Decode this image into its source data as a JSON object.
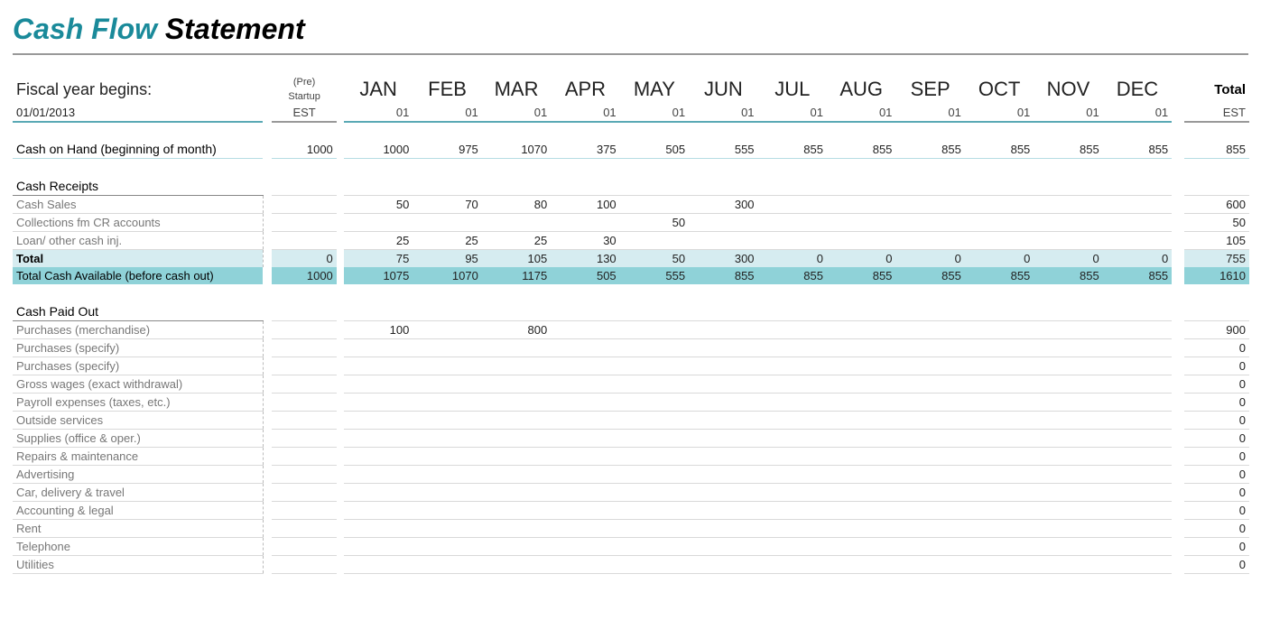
{
  "title": {
    "part1": "Cash Flow",
    "part2": "Statement"
  },
  "fiscal": {
    "label": "Fiscal year begins:",
    "date": "01/01/2013"
  },
  "header": {
    "preTop": "(Pre)",
    "preMid": "Startup",
    "preBot": "EST",
    "months": [
      "JAN",
      "FEB",
      "MAR",
      "APR",
      "MAY",
      "JUN",
      "JUL",
      "AUG",
      "SEP",
      "OCT",
      "NOV",
      "DEC"
    ],
    "monthSub": "01",
    "totalTop": "Total",
    "totalBot": "EST"
  },
  "cashOnHand": {
    "label": "Cash on Hand (beginning of month)",
    "pre": "1000",
    "m": [
      "1000",
      "975",
      "1070",
      "375",
      "505",
      "555",
      "855",
      "855",
      "855",
      "855",
      "855",
      "855"
    ],
    "total": "855"
  },
  "receipts": {
    "heading": "Cash Receipts",
    "rows": [
      {
        "label": "Cash Sales",
        "pre": "",
        "m": [
          "50",
          "70",
          "80",
          "100",
          "",
          "300",
          "",
          "",
          "",
          "",
          "",
          ""
        ],
        "total": "600"
      },
      {
        "label": "Collections fm CR accounts",
        "pre": "",
        "m": [
          "",
          "",
          "",
          "",
          "50",
          "",
          "",
          "",
          "",
          "",
          "",
          ""
        ],
        "total": "50"
      },
      {
        "label": "Loan/ other cash inj.",
        "pre": "",
        "m": [
          "25",
          "25",
          "25",
          "30",
          "",
          "",
          "",
          "",
          "",
          "",
          "",
          ""
        ],
        "total": "105"
      }
    ],
    "subtotal": {
      "label": "Total",
      "pre": "0",
      "m": [
        "75",
        "95",
        "105",
        "130",
        "50",
        "300",
        "0",
        "0",
        "0",
        "0",
        "0",
        "0"
      ],
      "total": "755"
    },
    "available": {
      "label": "Total Cash Available (before cash out)",
      "pre": "1000",
      "m": [
        "1075",
        "1070",
        "1175",
        "505",
        "555",
        "855",
        "855",
        "855",
        "855",
        "855",
        "855",
        "855"
      ],
      "total": "1610"
    }
  },
  "paidOut": {
    "heading": "Cash Paid Out",
    "rows": [
      {
        "label": "Purchases (merchandise)",
        "pre": "",
        "m": [
          "100",
          "",
          "800",
          "",
          "",
          "",
          "",
          "",
          "",
          "",
          "",
          ""
        ],
        "total": "900"
      },
      {
        "label": "Purchases (specify)",
        "pre": "",
        "m": [
          "",
          "",
          "",
          "",
          "",
          "",
          "",
          "",
          "",
          "",
          "",
          ""
        ],
        "total": "0"
      },
      {
        "label": "Purchases (specify)",
        "pre": "",
        "m": [
          "",
          "",
          "",
          "",
          "",
          "",
          "",
          "",
          "",
          "",
          "",
          ""
        ],
        "total": "0"
      },
      {
        "label": "Gross wages (exact withdrawal)",
        "pre": "",
        "m": [
          "",
          "",
          "",
          "",
          "",
          "",
          "",
          "",
          "",
          "",
          "",
          ""
        ],
        "total": "0"
      },
      {
        "label": "Payroll expenses (taxes, etc.)",
        "pre": "",
        "m": [
          "",
          "",
          "",
          "",
          "",
          "",
          "",
          "",
          "",
          "",
          "",
          ""
        ],
        "total": "0"
      },
      {
        "label": "Outside services",
        "pre": "",
        "m": [
          "",
          "",
          "",
          "",
          "",
          "",
          "",
          "",
          "",
          "",
          "",
          ""
        ],
        "total": "0"
      },
      {
        "label": "Supplies (office & oper.)",
        "pre": "",
        "m": [
          "",
          "",
          "",
          "",
          "",
          "",
          "",
          "",
          "",
          "",
          "",
          ""
        ],
        "total": "0"
      },
      {
        "label": "Repairs & maintenance",
        "pre": "",
        "m": [
          "",
          "",
          "",
          "",
          "",
          "",
          "",
          "",
          "",
          "",
          "",
          ""
        ],
        "total": "0"
      },
      {
        "label": "Advertising",
        "pre": "",
        "m": [
          "",
          "",
          "",
          "",
          "",
          "",
          "",
          "",
          "",
          "",
          "",
          ""
        ],
        "total": "0"
      },
      {
        "label": "Car, delivery & travel",
        "pre": "",
        "m": [
          "",
          "",
          "",
          "",
          "",
          "",
          "",
          "",
          "",
          "",
          "",
          ""
        ],
        "total": "0"
      },
      {
        "label": "Accounting & legal",
        "pre": "",
        "m": [
          "",
          "",
          "",
          "",
          "",
          "",
          "",
          "",
          "",
          "",
          "",
          ""
        ],
        "total": "0"
      },
      {
        "label": "Rent",
        "pre": "",
        "m": [
          "",
          "",
          "",
          "",
          "",
          "",
          "",
          "",
          "",
          "",
          "",
          ""
        ],
        "total": "0"
      },
      {
        "label": "Telephone",
        "pre": "",
        "m": [
          "",
          "",
          "",
          "",
          "",
          "",
          "",
          "",
          "",
          "",
          "",
          ""
        ],
        "total": "0"
      },
      {
        "label": "Utilities",
        "pre": "",
        "m": [
          "",
          "",
          "",
          "",
          "",
          "",
          "",
          "",
          "",
          "",
          "",
          ""
        ],
        "total": "0"
      }
    ]
  }
}
